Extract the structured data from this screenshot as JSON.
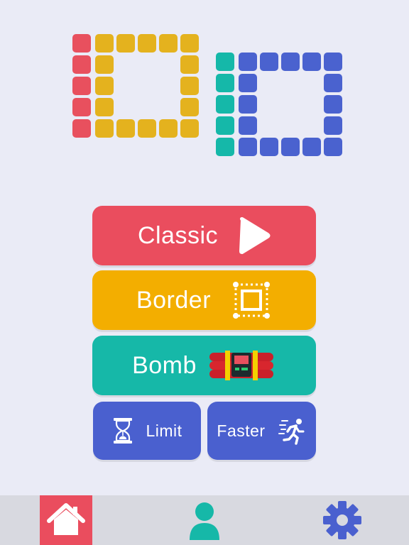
{
  "colors": {
    "background": "#eaebf6",
    "red": "#e8505e",
    "yellow": "#e4b21e",
    "teal": "#15b8a9",
    "blue": "#4a62cf",
    "button_classic": "#ea4d5e",
    "button_border": "#f3ae00",
    "button_bomb": "#16b8a8",
    "button_blue": "#4a60cf",
    "navbar": "#d8d9e0",
    "nav_active": "#ea4d5e",
    "nav_icon": "#16b8a8",
    "settings_icon": "#4a60cf"
  },
  "logo": {
    "text": "1010",
    "icon": "tile-logo"
  },
  "menu": {
    "classic": {
      "label": "Classic",
      "icon": "play-icon"
    },
    "border": {
      "label": "Border",
      "icon": "border-square-icon"
    },
    "bomb": {
      "label": "Bomb",
      "icon": "dynamite-icon"
    },
    "limit": {
      "label": "Limit",
      "icon": "hourglass-icon"
    },
    "faster": {
      "label": "Faster",
      "icon": "running-man-icon"
    }
  },
  "navbar": {
    "items": [
      {
        "name": "home",
        "icon": "house-icon",
        "active": true
      },
      {
        "name": "profile",
        "icon": "user-icon",
        "active": false
      },
      {
        "name": "settings",
        "icon": "gear-icon",
        "active": false
      }
    ]
  }
}
